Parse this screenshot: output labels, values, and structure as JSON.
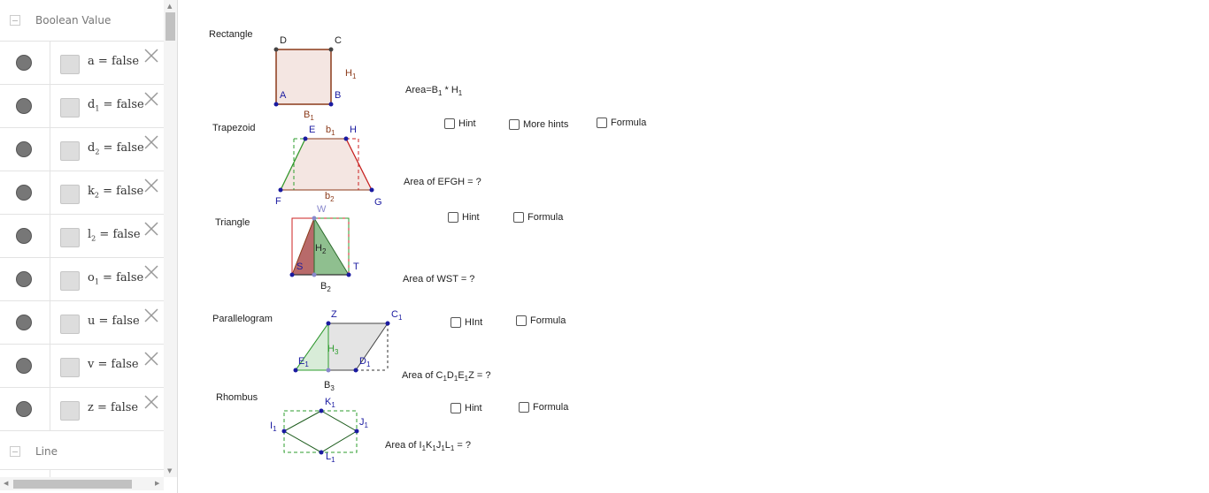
{
  "algebra": {
    "group1": "Boolean Value",
    "group2": "Line",
    "rows": [
      {
        "name": "a",
        "sub": "",
        "value": "false"
      },
      {
        "name": "d",
        "sub": "1",
        "value": "false"
      },
      {
        "name": "d",
        "sub": "2",
        "value": "false"
      },
      {
        "name": "k",
        "sub": "2",
        "value": "false"
      },
      {
        "name": "l",
        "sub": "2",
        "value": "false"
      },
      {
        "name": "o",
        "sub": "1",
        "value": "false"
      },
      {
        "name": "u",
        "sub": "",
        "value": "false"
      },
      {
        "name": "v",
        "sub": "",
        "value": "false"
      },
      {
        "name": "z",
        "sub": "",
        "value": "false"
      }
    ]
  },
  "shapes": {
    "rectangle": {
      "title": "Rectangle",
      "area": "Area=B",
      "area_b": "1",
      "area_mid": " * H",
      "area_h": "1",
      "pts": {
        "A": "A",
        "B": "B",
        "C": "C",
        "D": "D"
      },
      "H": "H",
      "Hs": "1",
      "B": "B",
      "Bs": "1"
    },
    "trapezoid": {
      "title": "Trapezoid",
      "area": "Area of EFGH = ?",
      "hint": "Hint",
      "more": "More hints",
      "formula": "Formula",
      "pts": {
        "E": "E",
        "F": "F",
        "G": "G",
        "H": "H"
      },
      "b1": "b",
      "b1s": "1",
      "b2": "b",
      "b2s": "2"
    },
    "triangle": {
      "title": "Triangle",
      "area": "Area of WST = ?",
      "hint": "Hint",
      "formula": "Formula",
      "pts": {
        "W": "W",
        "S": "S",
        "T": "T"
      },
      "H": "H",
      "Hs": "2",
      "B": "B",
      "Bs": "2"
    },
    "parallelogram": {
      "title": "Parallelogram",
      "area_pre": "Area of C",
      "s1": "1",
      "d": "D",
      "s2": "1",
      "e": "E",
      "s3": "1",
      "area_post": "Z = ?",
      "hint": "HInt",
      "formula": "Formula",
      "pts": {
        "Z": "Z",
        "C": "C",
        "Cs": "1",
        "E": "E",
        "Es": "1",
        "D": "D",
        "Ds": "1"
      },
      "H": "H",
      "Hs": "3",
      "B": "B",
      "Bs": "3"
    },
    "rhombus": {
      "title": "Rhombus",
      "area_pre": "Area of I",
      "s1": "1",
      "k": "K",
      "s2": "1",
      "j": "J",
      "s3": "1",
      "l": "L",
      "s4": "1",
      "area_post": " = ?",
      "hint": "Hint",
      "formula": "Formula",
      "pts": {
        "I": "I",
        "Is": "1",
        "K": "K",
        "Ks": "1",
        "J": "J",
        "Js": "1",
        "L": "L",
        "Ls": "1"
      }
    }
  },
  "colors": {
    "brown": "#8b3a1a",
    "fill": "#f4e6e2",
    "blue": "#1a1aa0",
    "green": "#2e9e2e",
    "red": "#cc2222"
  }
}
